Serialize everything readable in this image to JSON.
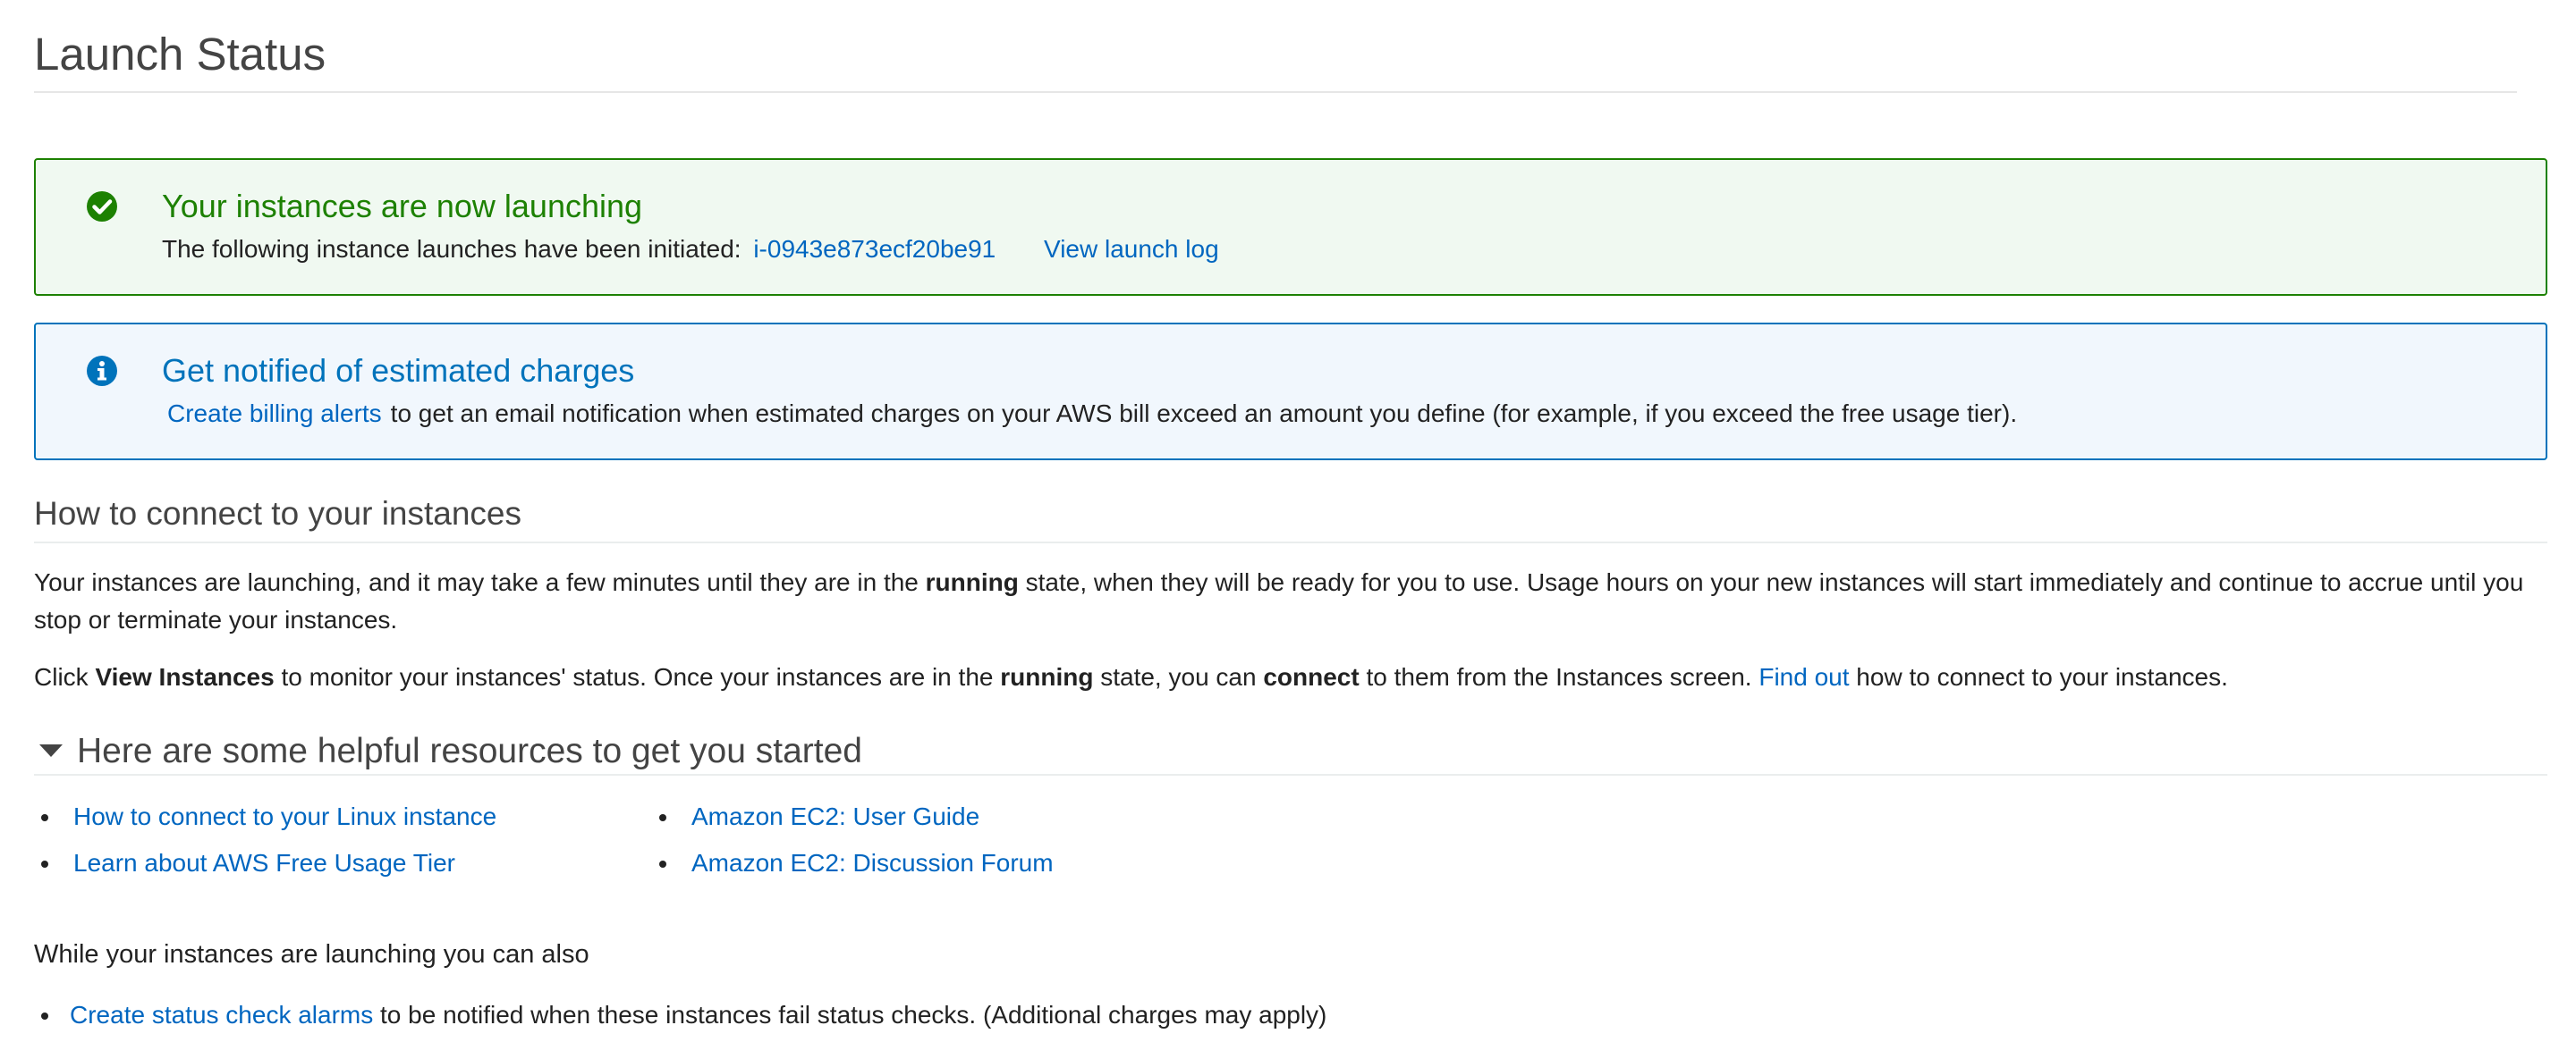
{
  "page": {
    "title": "Launch Status"
  },
  "success_alert": {
    "heading": "Your instances are now launching",
    "body_prefix": "The following instance launches have been initiated:",
    "instance_id": "i-0943e873ecf20be91",
    "view_log_label": "View launch log",
    "icon": "check-circle-icon",
    "color": "#1d8102"
  },
  "info_alert": {
    "heading": "Get notified of estimated charges",
    "link_label": "Create billing alerts",
    "body_suffix": "to get an email notification when estimated charges on your AWS bill exceed an amount you define (for example, if you exceed the free usage tier).",
    "icon": "info-circle-icon",
    "color": "#0073bb"
  },
  "connect": {
    "heading": "How to connect to your instances",
    "para1_a": "Your instances are launching, and it may take a few minutes until they are in the ",
    "para1_bold": "running",
    "para1_b": " state, when they will be ready for you to use. Usage hours on your new instances will start immediately and continue to accrue until you stop or terminate your instances.",
    "para2_a": "Click ",
    "para2_bold1": "View Instances",
    "para2_b": " to monitor your instances' status. Once your instances are in the ",
    "para2_bold2": "running",
    "para2_c": " state, you can ",
    "para2_bold3": "connect",
    "para2_d": " to them from the Instances screen. ",
    "find_out_label": "Find out",
    "para2_e": " how to connect to your instances."
  },
  "resources": {
    "heading": "Here are some helpful resources to get you started",
    "left": [
      "How to connect to your Linux instance",
      "Learn about AWS Free Usage Tier"
    ],
    "right": [
      "Amazon EC2: User Guide",
      "Amazon EC2: Discussion Forum"
    ]
  },
  "also": {
    "heading": "While your instances are launching you can also",
    "item_link": "Create status check alarms",
    "item_suffix": "to be notified when these instances fail status checks. (Additional charges may apply)"
  },
  "colors": {
    "link": "#0066c0",
    "text": "#222222"
  }
}
